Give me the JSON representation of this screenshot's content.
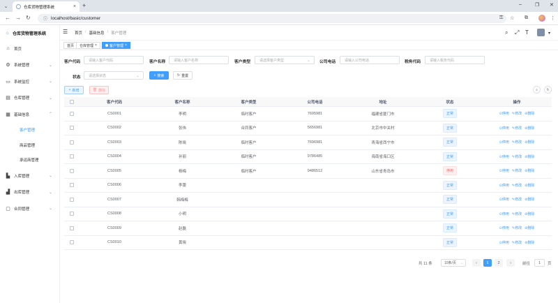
{
  "browser": {
    "tab_title": "仓库货物管理系统",
    "url": "localhost/basic/customer"
  },
  "app": {
    "brand": "仓库货物管理系统"
  },
  "sidebar": {
    "items": [
      {
        "label": "首页",
        "icon": "home-icon"
      },
      {
        "label": "系统管理",
        "icon": "gear-icon"
      },
      {
        "label": "系统监控",
        "icon": "monitor-icon"
      },
      {
        "label": "仓库管理",
        "icon": "warehouse-icon"
      },
      {
        "label": "基础信息",
        "icon": "info-icon"
      }
    ],
    "submenu": [
      {
        "label": "客户管理",
        "active": true
      },
      {
        "label": "商品管理"
      },
      {
        "label": "承运商管理"
      }
    ],
    "items_after": [
      {
        "label": "入库管理",
        "icon": "inbound-icon"
      },
      {
        "label": "出库管理",
        "icon": "outbound-icon"
      },
      {
        "label": "合同管理",
        "icon": "contract-icon"
      }
    ]
  },
  "header": {
    "breadcrumb": [
      "首页",
      "基础信息",
      "客户管理"
    ]
  },
  "tags": [
    {
      "label": "首页"
    },
    {
      "label": "仓库管理"
    },
    {
      "label": "客户管理",
      "active": true
    }
  ],
  "search": {
    "code_label": "客户代码",
    "code_placeholder": "请输入客户代码",
    "name_label": "客户名称",
    "name_placeholder": "请输入客户名称",
    "type_label": "客户类型",
    "type_placeholder": "请选择客户类型",
    "phone_label": "公司电话",
    "phone_placeholder": "请输入公司电话",
    "tax_label": "税务代码",
    "tax_placeholder": "请输入税务代码",
    "status_label": "状态",
    "status_placeholder": "请选择状态",
    "search_btn": "搜索",
    "reset_btn": "重置"
  },
  "toolbar": {
    "add_btn": "新增",
    "delete_btn": "删除"
  },
  "table": {
    "columns": [
      "客户代码",
      "客户名称",
      "客户类型",
      "公司电话",
      "地址",
      "状态",
      "操作"
    ],
    "rows": [
      {
        "code": "CS0001",
        "name": "李明",
        "type": "临时客户",
        "phone": "7695981",
        "addr": "福建省厦门市",
        "status": "正常",
        "status_on": true
      },
      {
        "code": "CS0002",
        "name": "张伟",
        "type": "合同客户",
        "phone": "5656981",
        "addr": "北京市中关村",
        "status": "正常",
        "status_on": true
      },
      {
        "code": "CS0003",
        "name": "陈晓",
        "type": "临时客户",
        "phone": "7696981",
        "addr": "青海省西宁市",
        "status": "正常",
        "status_on": true
      },
      {
        "code": "CS0004",
        "name": "孙丽",
        "type": "临时客户",
        "phone": "9786485",
        "addr": "海南省海口区",
        "status": "正常",
        "status_on": true
      },
      {
        "code": "CS0005",
        "name": "杨梅",
        "type": "临时客户",
        "phone": "9486512",
        "addr": "山东省青岛市",
        "status": "停用",
        "status_on": false
      },
      {
        "code": "CS0006",
        "name": "李蕾",
        "type": "",
        "phone": "",
        "addr": "",
        "status": "正常",
        "status_on": true
      },
      {
        "code": "CS0007",
        "name": "韩梅梅",
        "type": "",
        "phone": "",
        "addr": "",
        "status": "正常",
        "status_on": true
      },
      {
        "code": "CS0008",
        "name": "小明",
        "type": "",
        "phone": "",
        "addr": "",
        "status": "正常",
        "status_on": true
      },
      {
        "code": "CS0009",
        "name": "赵磊",
        "type": "",
        "phone": "",
        "addr": "",
        "status": "正常",
        "status_on": true
      },
      {
        "code": "CS0010",
        "name": "黄晓",
        "type": "",
        "phone": "",
        "addr": "",
        "status": "正常",
        "status_on": true
      }
    ],
    "ops": [
      "停用",
      "修改",
      "删除"
    ]
  },
  "pagination": {
    "total": "共 11 条",
    "page_size": "10条/页",
    "pages": [
      "1",
      "2"
    ],
    "current": "1",
    "goto_label": "前往",
    "goto_value": "1",
    "page_unit": "页"
  },
  "colors": {
    "primary": "#409eff",
    "danger": "#f56c6c"
  }
}
